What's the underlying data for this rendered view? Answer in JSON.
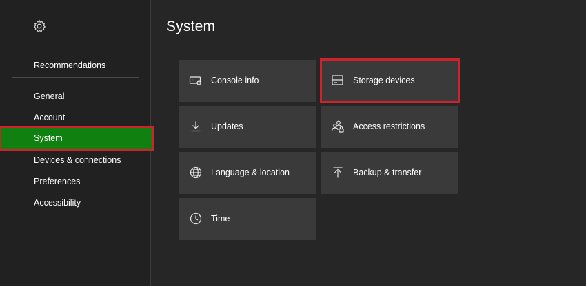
{
  "page": {
    "title": "System",
    "accent": "#108010",
    "highlight": "#d0222a"
  },
  "sidebar": {
    "top_item": "Recommendations",
    "items": [
      {
        "label": "General"
      },
      {
        "label": "Account"
      },
      {
        "label": "System",
        "selected": true
      },
      {
        "label": "Devices & connections"
      },
      {
        "label": "Preferences"
      },
      {
        "label": "Accessibility"
      }
    ]
  },
  "tiles": [
    {
      "label": "Console info",
      "icon": "console-info-icon"
    },
    {
      "label": "Storage devices",
      "icon": "storage-icon",
      "highlighted": true
    },
    {
      "label": "Updates",
      "icon": "download-icon"
    },
    {
      "label": "Access restrictions",
      "icon": "users-lock-icon"
    },
    {
      "label": "Language & location",
      "icon": "globe-icon"
    },
    {
      "label": "Backup & transfer",
      "icon": "upload-icon"
    },
    {
      "label": "Time",
      "icon": "clock-icon"
    }
  ]
}
